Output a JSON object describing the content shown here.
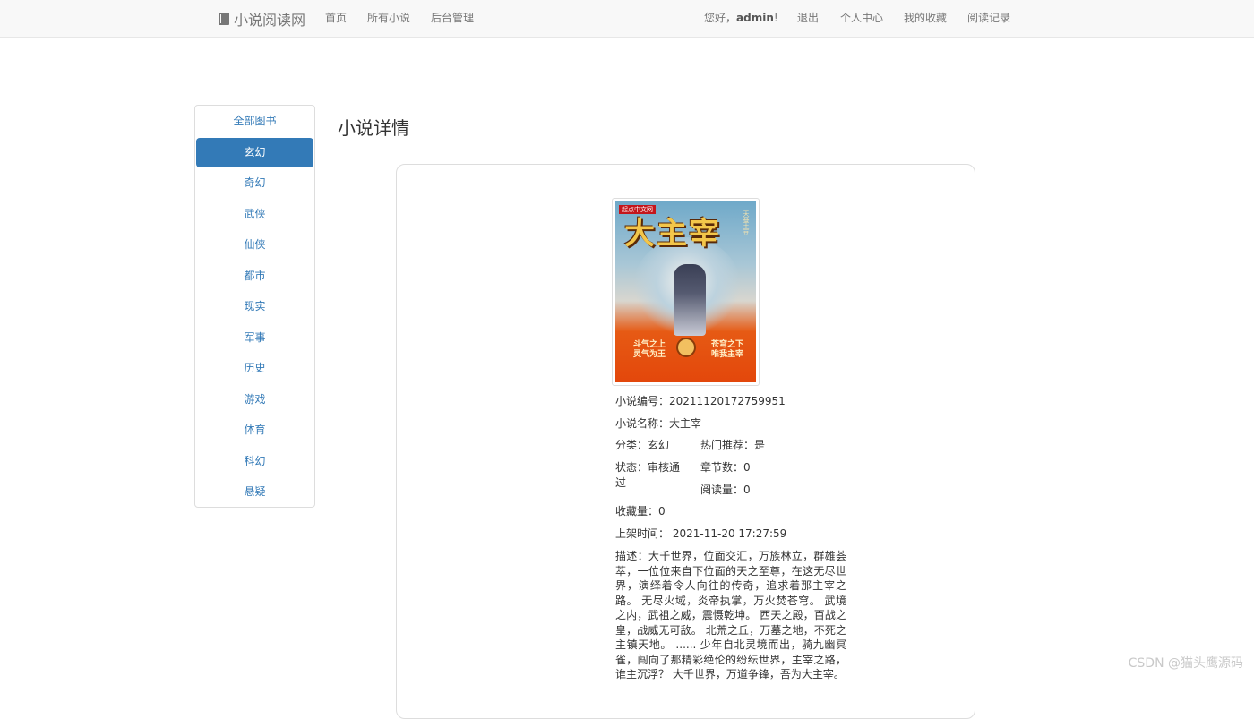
{
  "navbar": {
    "brand": "小说阅读网",
    "brand_icon": "book-icon",
    "links": [
      "首页",
      "所有小说",
      "后台管理"
    ],
    "greeting_prefix": "您好，",
    "username": "admin",
    "greeting_suffix": "!",
    "right_links": [
      "退出",
      "个人中心",
      "我的收藏",
      "阅读记录"
    ]
  },
  "sidebar": {
    "items": [
      {
        "label": "全部图书"
      },
      {
        "label": "玄幻",
        "active": true
      },
      {
        "label": "奇幻"
      },
      {
        "label": "武侠"
      },
      {
        "label": "仙侠"
      },
      {
        "label": "都市"
      },
      {
        "label": "现实"
      },
      {
        "label": "军事"
      },
      {
        "label": "历史"
      },
      {
        "label": "游戏"
      },
      {
        "label": "体育"
      },
      {
        "label": "科幻"
      },
      {
        "label": "悬疑"
      }
    ],
    "active_color": "#337ab7"
  },
  "main": {
    "title": "小说详情",
    "cover": {
      "title": "大主宰",
      "publisher": "起点中文网",
      "author": "天蚕土豆",
      "tagline_left": [
        "斗气之上",
        "灵气为王"
      ],
      "tagline_right": [
        "苍穹之下",
        "唯我主宰"
      ]
    },
    "fields": {
      "id_label": "小说编号：",
      "id_value": "20211120172759951",
      "name_label": "小说名称：",
      "name_value": "大主宰",
      "category_label": "分类：",
      "category_value": "玄幻",
      "hot_label": "热门推荐：",
      "hot_value": "是",
      "status_label": "状态：",
      "status_value": "审核通过",
      "chapters_label": "章节数：",
      "chapters_value": "0",
      "reads_label": "阅读量：",
      "reads_value": "0",
      "favorites_label": "收藏量：",
      "favorites_value": "0",
      "shelf_time_label": "上架时间：",
      "shelf_time_value": "2021-11-20 17:27:59",
      "desc_label": "描述：",
      "desc_value": "大千世界，位面交汇，万族林立，群雄荟萃，一位位来自下位面的天之至尊，在这无尽世界，演绎着令人向往的传奇，追求着那主宰之路。 无尽火域，炎帝执掌，万火焚苍穹。 武境之内，武祖之威，震慑乾坤。 西天之殿，百战之皇，战威无可敌。 北荒之丘，万墓之地，不死之主镇天地。 ...... 少年自北灵境而出，骑九幽冥雀，闯向了那精彩绝伦的纷纭世界，主宰之路，谁主沉浮？ 大千世界，万道争锋，吾为大主宰。"
    }
  },
  "watermark": "CSDN @猫头鹰源码"
}
